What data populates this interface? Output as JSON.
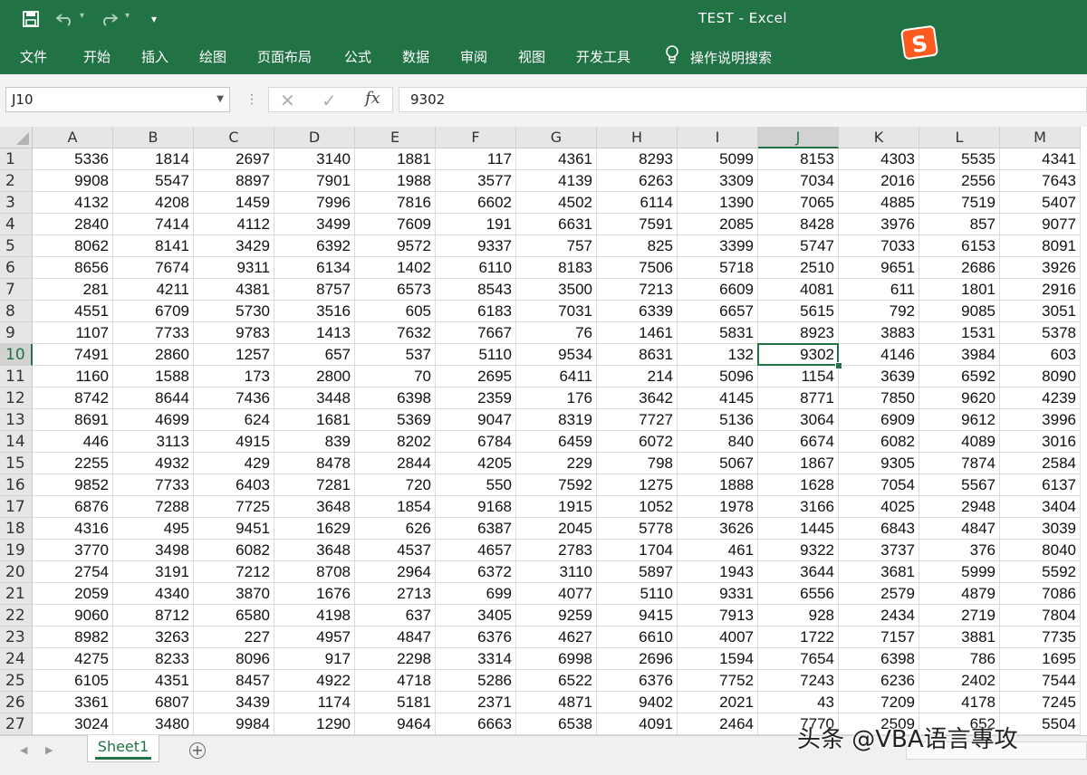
{
  "titlebar": {
    "title": "TEST  -  Excel",
    "save_icon": "save-icon",
    "undo_icon": "undo-icon",
    "redo_icon": "redo-icon",
    "customize_icon": "customize-qat-icon"
  },
  "ribbon": {
    "tabs": [
      "文件",
      "开始",
      "插入",
      "绘图",
      "页面布局",
      "公式",
      "数据",
      "审阅",
      "视图",
      "开发工具"
    ],
    "search_label": "操作说明搜索",
    "search_icon": "lightbulb-icon",
    "ime_logo": "S"
  },
  "formula_bar": {
    "name_box": "J10",
    "formula_value": "9302",
    "cancel_icon": "✕",
    "enter_icon": "✓",
    "fx_label": "fx"
  },
  "sheet": {
    "columns": [
      "A",
      "B",
      "C",
      "D",
      "E",
      "F",
      "G",
      "H",
      "I",
      "J",
      "K",
      "L",
      "M"
    ],
    "row_numbers": [
      "1",
      "2",
      "3",
      "4",
      "5",
      "6",
      "7",
      "8",
      "9",
      "10",
      "11",
      "12",
      "13",
      "14",
      "15",
      "16",
      "17",
      "18",
      "19",
      "20",
      "21",
      "22",
      "23",
      "24",
      "25",
      "26",
      "27"
    ],
    "selected_column": "J",
    "selected_row": "10",
    "rows": [
      [
        "5336",
        "1814",
        "2697",
        "3140",
        "1881",
        "117",
        "4361",
        "8293",
        "5099",
        "8153",
        "4303",
        "5535",
        "4341"
      ],
      [
        "9908",
        "5547",
        "8897",
        "7901",
        "1988",
        "3577",
        "4139",
        "6263",
        "3309",
        "7034",
        "2016",
        "2556",
        "7643"
      ],
      [
        "4132",
        "4208",
        "1459",
        "7996",
        "7816",
        "6602",
        "4502",
        "6114",
        "1390",
        "7065",
        "4885",
        "7519",
        "5407"
      ],
      [
        "2840",
        "7414",
        "4112",
        "3499",
        "7609",
        "191",
        "6631",
        "7591",
        "2085",
        "8428",
        "3976",
        "857",
        "9077"
      ],
      [
        "8062",
        "8141",
        "3429",
        "6392",
        "9572",
        "9337",
        "757",
        "825",
        "3399",
        "5747",
        "7033",
        "6153",
        "8091"
      ],
      [
        "8656",
        "7674",
        "9311",
        "6134",
        "1402",
        "6110",
        "8183",
        "7506",
        "5718",
        "2510",
        "9651",
        "2686",
        "3926"
      ],
      [
        "281",
        "4211",
        "4381",
        "8757",
        "6573",
        "8543",
        "3500",
        "7213",
        "6609",
        "4081",
        "611",
        "1801",
        "2916"
      ],
      [
        "4551",
        "6709",
        "5730",
        "3516",
        "605",
        "6183",
        "7031",
        "6339",
        "6657",
        "5615",
        "792",
        "9085",
        "3051"
      ],
      [
        "1107",
        "7733",
        "9783",
        "1413",
        "7632",
        "7667",
        "76",
        "1461",
        "5831",
        "8923",
        "3883",
        "1531",
        "5378"
      ],
      [
        "7491",
        "2860",
        "1257",
        "657",
        "537",
        "5110",
        "9534",
        "8631",
        "132",
        "9302",
        "4146",
        "3984",
        "603"
      ],
      [
        "1160",
        "1588",
        "173",
        "2800",
        "70",
        "2695",
        "6411",
        "214",
        "5096",
        "1154",
        "3639",
        "6592",
        "8090"
      ],
      [
        "8742",
        "8644",
        "7436",
        "3448",
        "6398",
        "2359",
        "176",
        "3642",
        "4145",
        "8771",
        "7850",
        "9620",
        "4239"
      ],
      [
        "8691",
        "4699",
        "624",
        "1681",
        "5369",
        "9047",
        "8319",
        "7727",
        "5136",
        "3064",
        "6909",
        "9612",
        "3996"
      ],
      [
        "446",
        "3113",
        "4915",
        "839",
        "8202",
        "6784",
        "6459",
        "6072",
        "840",
        "6674",
        "6082",
        "4089",
        "3016"
      ],
      [
        "2255",
        "4932",
        "429",
        "8478",
        "2844",
        "4205",
        "229",
        "798",
        "5067",
        "1867",
        "9305",
        "7874",
        "2584"
      ],
      [
        "9852",
        "7733",
        "6403",
        "7281",
        "720",
        "550",
        "7592",
        "1275",
        "1888",
        "1628",
        "7054",
        "5567",
        "6137"
      ],
      [
        "6876",
        "7288",
        "7725",
        "3648",
        "1854",
        "9168",
        "1915",
        "1052",
        "1978",
        "3166",
        "4025",
        "2948",
        "3404"
      ],
      [
        "4316",
        "495",
        "9451",
        "1629",
        "626",
        "6387",
        "2045",
        "5778",
        "3626",
        "1445",
        "6843",
        "4847",
        "3039"
      ],
      [
        "3770",
        "3498",
        "6082",
        "3648",
        "4537",
        "4657",
        "2783",
        "1704",
        "461",
        "9322",
        "3737",
        "376",
        "8040"
      ],
      [
        "2754",
        "3191",
        "7212",
        "8708",
        "2964",
        "6372",
        "3110",
        "5897",
        "1943",
        "3644",
        "3681",
        "5999",
        "5592"
      ],
      [
        "2059",
        "4340",
        "3870",
        "1676",
        "2713",
        "699",
        "4077",
        "5110",
        "9331",
        "6556",
        "2579",
        "4879",
        "7086"
      ],
      [
        "9060",
        "8712",
        "6580",
        "4198",
        "637",
        "3405",
        "9259",
        "9415",
        "7913",
        "928",
        "2434",
        "2719",
        "7804"
      ],
      [
        "8982",
        "3263",
        "227",
        "4957",
        "4847",
        "6376",
        "4627",
        "6610",
        "4007",
        "1722",
        "7157",
        "3881",
        "7735"
      ],
      [
        "4275",
        "8233",
        "8096",
        "917",
        "2298",
        "3314",
        "6998",
        "2696",
        "1594",
        "7654",
        "6398",
        "786",
        "1695"
      ],
      [
        "6105",
        "4351",
        "8457",
        "4922",
        "4718",
        "5286",
        "6522",
        "6376",
        "7752",
        "7243",
        "6236",
        "2402",
        "7544"
      ],
      [
        "3361",
        "6807",
        "3439",
        "1174",
        "5181",
        "2371",
        "4871",
        "9402",
        "2021",
        "43",
        "7209",
        "4178",
        "7245"
      ],
      [
        "3024",
        "3480",
        "9984",
        "1290",
        "9464",
        "6663",
        "6538",
        "4091",
        "2464",
        "7770",
        "2509",
        "652",
        "5504"
      ]
    ]
  },
  "sheet_tabs": {
    "tabs": [
      "Sheet1"
    ],
    "add_icon": "+",
    "prev_icon": "◀",
    "next_icon": "▶"
  },
  "watermark": "头条 @VBA语言專攻",
  "colors": {
    "accent": "#217346",
    "header_bg": "#e6e6e6",
    "grid_line": "#dcdcdc"
  }
}
